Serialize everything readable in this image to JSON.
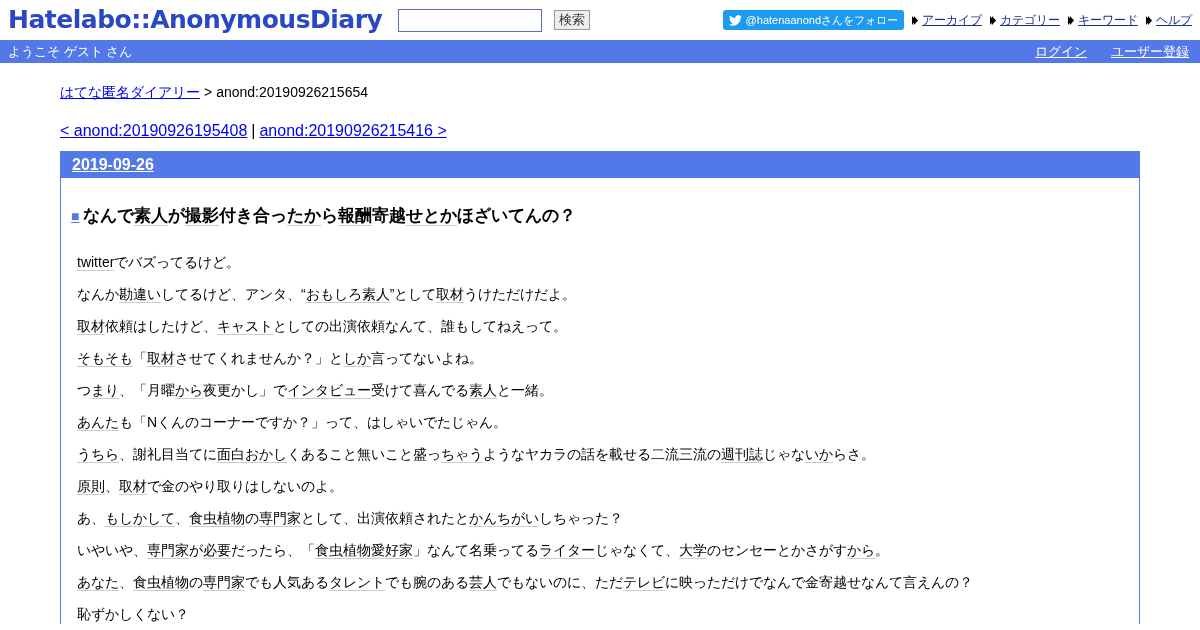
{
  "header": {
    "logo": "Hatelabo::AnonymousDiary",
    "search": {
      "button": "検索"
    },
    "follow_button": "@hatenaanondさんをフォロー",
    "nav_links": [
      "アーカイブ",
      "カテゴリー",
      "キーワード",
      "ヘルプ"
    ]
  },
  "user_bar": {
    "welcome": "ようこそ ゲスト さん",
    "links": [
      "ログイン",
      "ユーザー登録"
    ]
  },
  "breadcrumb": {
    "home": "はてな匿名ダイアリー",
    "separator": ">",
    "current": "anond:20190926215654"
  },
  "pager": {
    "prev": "< anond:20190926195408",
    "separator": "|",
    "next": "anond:20190926215416 >"
  },
  "day": {
    "date": "2019-09-26",
    "title_mark": "■",
    "title": [
      {
        "text": "なんで",
        "keyword": false
      },
      {
        "text": "素人",
        "keyword": true
      },
      {
        "text": "が",
        "keyword": false
      },
      {
        "text": "撮影",
        "keyword": true
      },
      {
        "text": "付き合っ",
        "keyword": false
      },
      {
        "text": "たか",
        "keyword": true
      },
      {
        "text": "ら",
        "keyword": false
      },
      {
        "text": "報酬",
        "keyword": true
      },
      {
        "text": "寄越",
        "keyword": false
      },
      {
        "text": "せとか",
        "keyword": true
      },
      {
        "text": "ほざいてんの？",
        "keyword": false
      }
    ],
    "paragraphs": [
      [
        {
          "text": "twitter",
          "keyword": true
        },
        {
          "text": "でバズってるけど。",
          "keyword": false
        }
      ],
      [
        {
          "text": "なんか",
          "keyword": false
        },
        {
          "text": "勘違い",
          "keyword": true
        },
        {
          "text": "してるけど、アンタ、“",
          "keyword": false
        },
        {
          "text": "おもしろ素人",
          "keyword": true
        },
        {
          "text": "”として",
          "keyword": false
        },
        {
          "text": "取材",
          "keyword": true
        },
        {
          "text": "うけただけだよ。",
          "keyword": false
        }
      ],
      [
        {
          "text": "取材",
          "keyword": true
        },
        {
          "text": "依頼はしたけど、",
          "keyword": false
        },
        {
          "text": "キャスト",
          "keyword": true
        },
        {
          "text": "としての出演依頼なんて、誰もしてねえって。",
          "keyword": false
        }
      ],
      [
        {
          "text": "そもそも",
          "keyword": true
        },
        {
          "text": "「",
          "keyword": false
        },
        {
          "text": "取材",
          "keyword": true
        },
        {
          "text": "させてくれませんか？」と",
          "keyword": false
        },
        {
          "text": "しか",
          "keyword": true
        },
        {
          "text": "言ってないよね。",
          "keyword": false
        }
      ],
      [
        {
          "text": "つ",
          "keyword": false
        },
        {
          "text": "まり",
          "keyword": true
        },
        {
          "text": "、「月曜",
          "keyword": false
        },
        {
          "text": "から",
          "keyword": true
        },
        {
          "text": "夜更かし」で",
          "keyword": false
        },
        {
          "text": "インタビュー",
          "keyword": true
        },
        {
          "text": "受けて喜んでる",
          "keyword": false
        },
        {
          "text": "素人",
          "keyword": true
        },
        {
          "text": "と一緒。",
          "keyword": false
        }
      ],
      [
        {
          "text": "あんた",
          "keyword": true
        },
        {
          "text": "も「Nくんのコーナーですか？」って、はしゃいでたじゃん。",
          "keyword": false
        }
      ],
      [
        {
          "text": "うちら",
          "keyword": true
        },
        {
          "text": "、謝礼目当てに",
          "keyword": false
        },
        {
          "text": "面白おかし",
          "keyword": true
        },
        {
          "text": "くあること無いこと盛っ",
          "keyword": false
        },
        {
          "text": "ちゃう",
          "keyword": true
        },
        {
          "text": "ようなヤカラの話を載せる二流三流の",
          "keyword": false
        },
        {
          "text": "週刊誌",
          "keyword": true
        },
        {
          "text": "じゃな",
          "keyword": false
        },
        {
          "text": "いか",
          "keyword": true
        },
        {
          "text": "らさ。",
          "keyword": false
        }
      ],
      [
        {
          "text": "原則",
          "keyword": true
        },
        {
          "text": "、",
          "keyword": false
        },
        {
          "text": "取材",
          "keyword": true
        },
        {
          "text": "で金のやり取りはしないのよ。",
          "keyword": false
        }
      ],
      [
        {
          "text": "あ、",
          "keyword": false
        },
        {
          "text": "もしかして",
          "keyword": true
        },
        {
          "text": "、",
          "keyword": false
        },
        {
          "text": "食虫植物",
          "keyword": true
        },
        {
          "text": "の",
          "keyword": false
        },
        {
          "text": "専門家",
          "keyword": true
        },
        {
          "text": "として、出演依頼されたと",
          "keyword": false
        },
        {
          "text": "かんちがい",
          "keyword": true
        },
        {
          "text": "しちゃった？",
          "keyword": false
        }
      ],
      [
        {
          "text": "いやいや、",
          "keyword": false
        },
        {
          "text": "専門家",
          "keyword": true
        },
        {
          "text": "が",
          "keyword": false
        },
        {
          "text": "必要",
          "keyword": true
        },
        {
          "text": "だったら、「",
          "keyword": false
        },
        {
          "text": "食虫植物愛好家",
          "keyword": true
        },
        {
          "text": "」なんて名乗ってる",
          "keyword": false
        },
        {
          "text": "ライター",
          "keyword": true
        },
        {
          "text": "じゃなくて、",
          "keyword": false
        },
        {
          "text": "大学",
          "keyword": true
        },
        {
          "text": "のセンセーとかさがす",
          "keyword": false
        },
        {
          "text": "から",
          "keyword": true
        },
        {
          "text": "。",
          "keyword": false
        }
      ],
      [
        {
          "text": "あなた",
          "keyword": true
        },
        {
          "text": "、",
          "keyword": false
        },
        {
          "text": "食虫植物",
          "keyword": true
        },
        {
          "text": "の",
          "keyword": false
        },
        {
          "text": "専門家",
          "keyword": true
        },
        {
          "text": "でも人気ある",
          "keyword": false
        },
        {
          "text": "タレント",
          "keyword": true
        },
        {
          "text": "でも腕のある",
          "keyword": false
        },
        {
          "text": "芸人",
          "keyword": true
        },
        {
          "text": "でもないのに、ただ",
          "keyword": false
        },
        {
          "text": "テレビ",
          "keyword": true
        },
        {
          "text": "に映っただけでなんで金寄越せなんて言えんの？",
          "keyword": false
        }
      ],
      [
        {
          "text": "恥ずかしくない？",
          "keyword": false
        }
      ]
    ]
  }
}
